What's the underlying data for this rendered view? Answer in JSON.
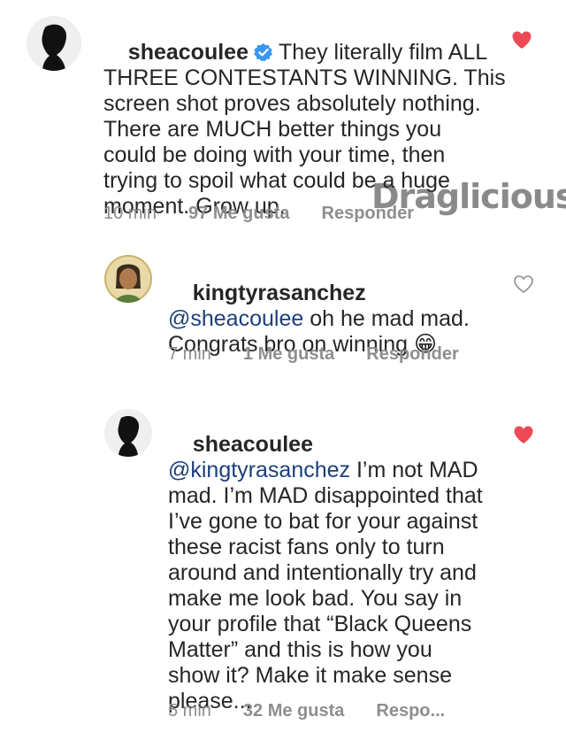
{
  "comments": [
    {
      "username": "sheacoulee",
      "verified": true,
      "body_lines": [
        "They literally film ALL",
        "THREE CONTESTANTS WINNING. This",
        "screen shot proves absolutely nothing.",
        "There are MUCH better things you",
        "could be doing with your time, then",
        "trying to spoil what could be a huge",
        "moment. Grow up."
      ],
      "time": "10 min",
      "likes": "97 Me gusta",
      "reply": "Responder",
      "liked": true
    },
    {
      "username": "kingtyrasanchez",
      "mention": "@sheacoulee",
      "body_lines": [
        " oh he mad mad.",
        "Congrats bro on winning 😁"
      ],
      "time": "7 min",
      "likes": "1 Me gusta",
      "reply": "Responder",
      "liked": false
    },
    {
      "username": "sheacoulee",
      "mention": "@kingtyrasanchez",
      "body_lines": [
        " I’m not MAD",
        "mad. I’m MAD disappointed that",
        "I’ve gone to bat for your against",
        "these racist fans only to turn",
        "around and intentionally try and",
        "make me look bad. You say in",
        "your profile that “Black Queens",
        "Matter” and this is how you",
        "show it? Make it make sense",
        "please..."
      ],
      "time": "5 min",
      "likes": "32 Me gusta",
      "reply": "Respo...",
      "liked": true
    }
  ],
  "watermark": {
    "text": "Draglicious"
  },
  "colors": {
    "heart_liked": "#ed4956",
    "heart_outline": "#8e8e8e",
    "verified": "#3897f0",
    "mention": "#1c3f7a",
    "meta": "#8e8e8e"
  }
}
